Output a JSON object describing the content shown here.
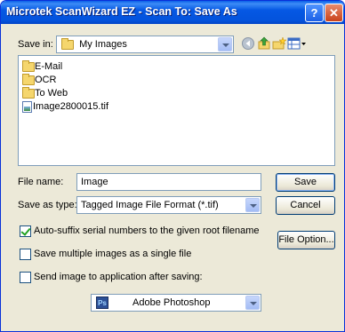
{
  "window": {
    "title": "Microtek ScanWizard EZ - Scan To: Save As",
    "help_glyph": "?",
    "close_glyph": "✕"
  },
  "save_in": {
    "label": "Save in:",
    "value": "My Images"
  },
  "toolbar_icons": [
    "back-icon",
    "up-folder-icon",
    "new-folder-icon",
    "view-menu-icon"
  ],
  "files": [
    {
      "name": "E-Mail",
      "kind": "folder"
    },
    {
      "name": "OCR",
      "kind": "folder"
    },
    {
      "name": "To Web",
      "kind": "folder"
    },
    {
      "name": "Image2800015.tif",
      "kind": "file"
    }
  ],
  "file_name": {
    "label": "File name:",
    "value": "Image"
  },
  "save_as_type": {
    "label": "Save as type:",
    "value": "Tagged Image File Format (*.tif)"
  },
  "buttons": {
    "save": "Save",
    "cancel": "Cancel",
    "file_option": "File Option..."
  },
  "options": {
    "auto_suffix": {
      "label": "Auto-suffix serial numbers to the given root filename",
      "checked": true
    },
    "multiple_single": {
      "label": "Save multiple images as a single file",
      "checked": false
    },
    "send_to_app": {
      "label": "Send image to application after saving:",
      "checked": false
    }
  },
  "application": {
    "icon_text": "Ps",
    "value": "Adobe Photoshop"
  }
}
